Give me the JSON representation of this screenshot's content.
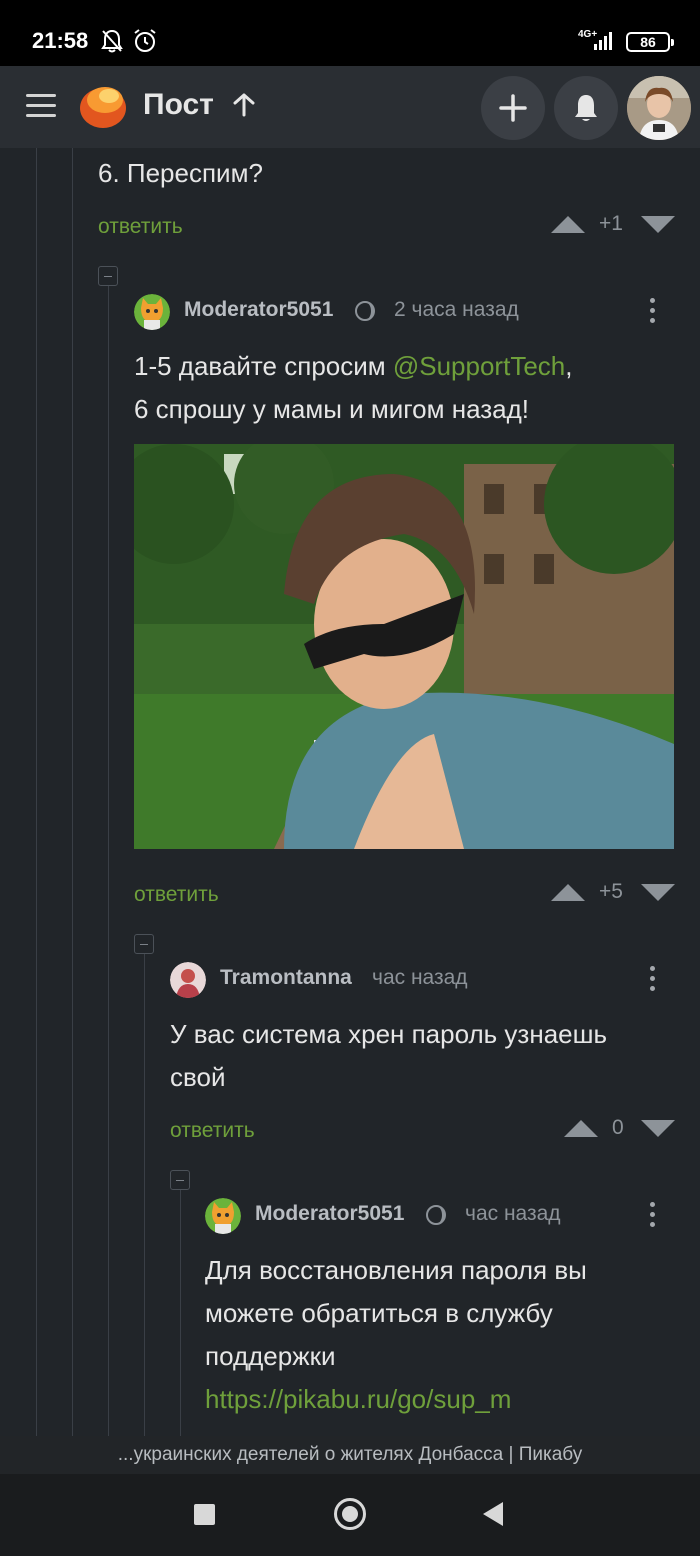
{
  "status_bar": {
    "time": "21:58",
    "network": "4G+",
    "battery": "86"
  },
  "header": {
    "title": "Пост"
  },
  "comments": [
    {
      "text": "6. Переспим?",
      "reply": "ответить",
      "votes": "+1"
    },
    {
      "author": "Moderator5051",
      "time": "2 часа назад",
      "text_before": "1-5 давайте спросим ",
      "mention": "@SupportTech",
      "text_after": ",",
      "text_line2": "6 спрошу у мамы и мигом назад!",
      "reply": "ответить",
      "votes": "+5"
    },
    {
      "author": "Tramontanna",
      "time": "час назад",
      "text_line1": "У вас система хрен пароль узнаешь",
      "text_line2": "свой",
      "reply": "ответить",
      "votes": "0"
    },
    {
      "author": "Moderator5051",
      "time": "час назад",
      "text_line1": "Для восстановления пароля вы",
      "text_line2": "можете обратиться в службу",
      "text_line3": "поддержки",
      "link": "https://pikabu.ru/go/sup_m"
    }
  ],
  "url_bar": {
    "title": "...украинских деятелей о жителях Донбасса | Пикабу"
  },
  "colors": {
    "accent_green": "#6fa03b",
    "background": "#212529",
    "header": "#2a2e33"
  }
}
